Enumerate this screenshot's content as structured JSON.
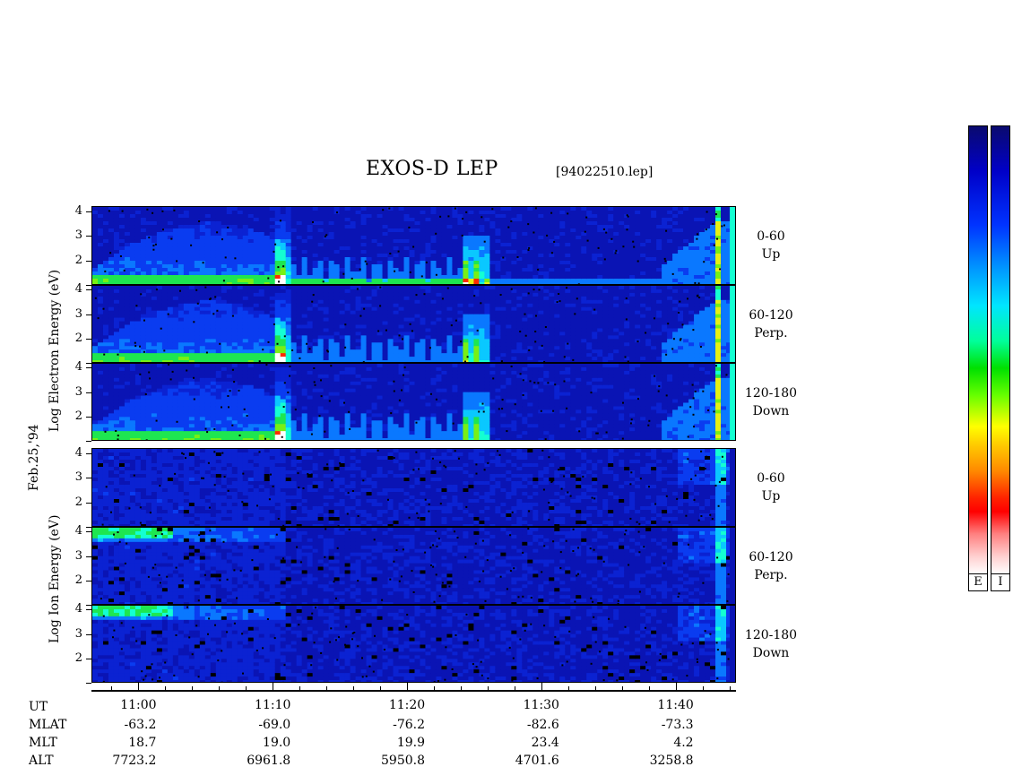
{
  "chart_data": {
    "type": "heatmap",
    "title": "EXOS-D LEP",
    "file_label": "[94022510.lep]",
    "date_label": "Feb.25,'94",
    "groups": [
      {
        "name": "Electron",
        "ylabel": "Log Electron Energy (eV)",
        "panels": [
          {
            "pitch": "0-60",
            "direction": "Up"
          },
          {
            "pitch": "60-120",
            "direction": "Perp."
          },
          {
            "pitch": "120-180",
            "direction": "Down"
          }
        ]
      },
      {
        "name": "Ion",
        "ylabel": "Log Ion Energy (eV)",
        "panels": [
          {
            "pitch": "0-60",
            "direction": "Up"
          },
          {
            "pitch": "60-120",
            "direction": "Perp."
          },
          {
            "pitch": "120-180",
            "direction": "Down"
          }
        ]
      }
    ],
    "y_ticks": [
      "4",
      "3",
      "2"
    ],
    "ylim": [
      1,
      4.2
    ],
    "x_range_minutes": [
      10.57,
      10.95
    ],
    "x_ticks": [
      {
        "ut": "11:00",
        "mlat": "-63.2",
        "mlt": "18.7",
        "alt": "7723.2"
      },
      {
        "ut": "11:10",
        "mlat": "-69.0",
        "mlt": "19.0",
        "alt": "6961.8"
      },
      {
        "ut": "11:20",
        "mlat": "-76.2",
        "mlt": "19.9",
        "alt": "5950.8"
      },
      {
        "ut": "11:30",
        "mlat": "-82.6",
        "mlt": "23.4",
        "alt": "4701.6"
      },
      {
        "ut": "11:40",
        "mlat": "-73.3",
        "mlt": "4.2",
        "alt": "3258.8"
      }
    ],
    "row_labels": [
      "UT",
      "MLAT",
      "MLT",
      "ALT"
    ],
    "colorbars": [
      {
        "label": "E"
      },
      {
        "label": "I"
      }
    ]
  }
}
